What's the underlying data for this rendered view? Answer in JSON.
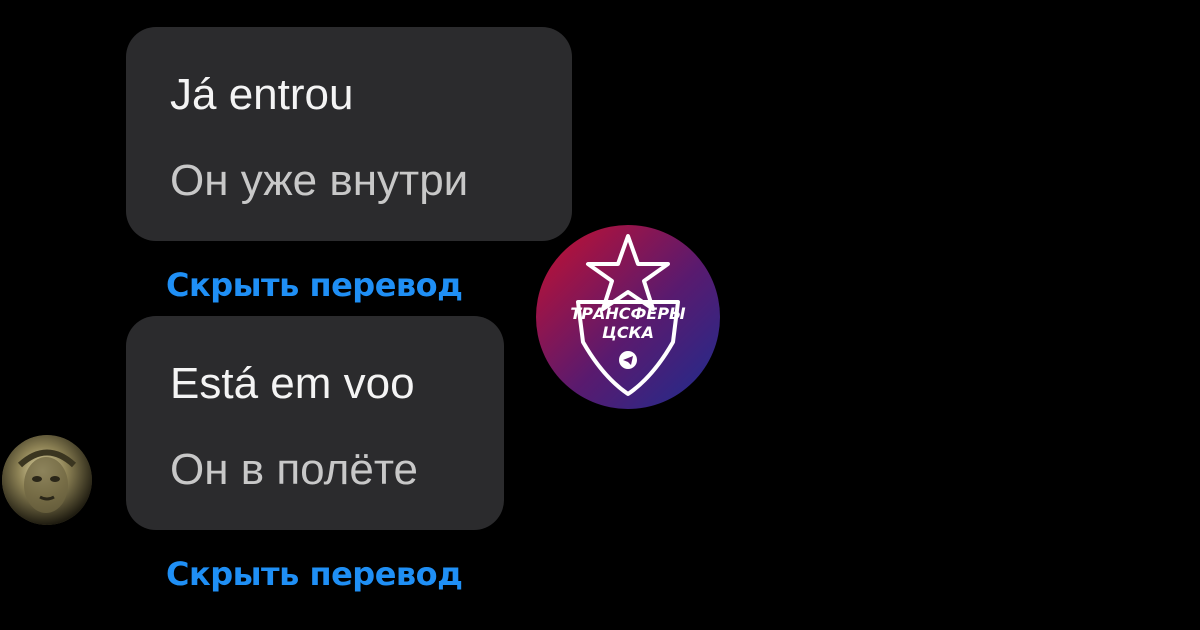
{
  "messages": [
    {
      "original": "Já entrou",
      "translation": "Он уже внутри",
      "hide_translation_label": "Скрыть перевод"
    },
    {
      "original": "Está em voo",
      "translation": "Он в полёте",
      "hide_translation_label": "Скрыть перевод"
    }
  ],
  "watermark": {
    "line1": "ТРАНСФЕРЫ",
    "line2": "ЦСКА",
    "icon": "telegram-icon"
  },
  "sender": {
    "avatar_icon": "user-avatar"
  },
  "colors": {
    "background": "#000000",
    "bubble": "#2b2b2d",
    "original_text": "#f4f4f4",
    "translated_text": "#c8c8c8",
    "link": "#1f8ff5",
    "logo_red": "#c8102e",
    "logo_blue": "#1b2d8f"
  }
}
